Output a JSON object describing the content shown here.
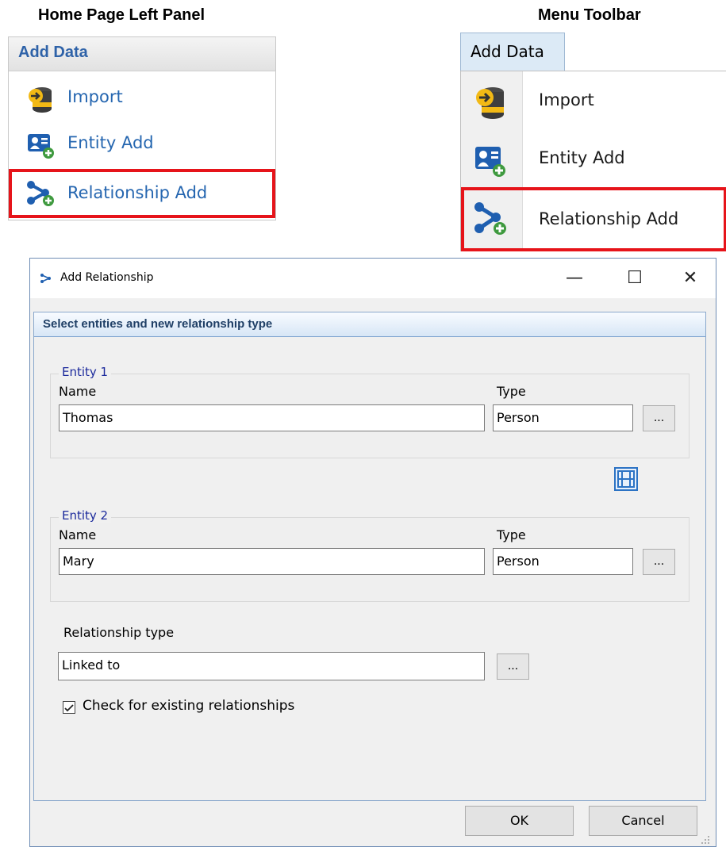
{
  "captions": {
    "left": "Home Page Left Panel",
    "right": "Menu Toolbar"
  },
  "left_panel": {
    "header": "Add Data",
    "items": [
      {
        "label": "Import",
        "icon": "import-database-icon"
      },
      {
        "label": "Entity Add",
        "icon": "entity-add-icon"
      },
      {
        "label": "Relationship Add",
        "icon": "relationship-add-icon",
        "highlighted": true
      }
    ]
  },
  "menu_toolbar": {
    "tab": "Add Data",
    "items": [
      {
        "label": "Import",
        "icon": "import-database-icon"
      },
      {
        "label": "Entity Add",
        "icon": "entity-add-icon"
      },
      {
        "label": "Relationship Add",
        "icon": "relationship-add-icon",
        "highlighted": true
      }
    ]
  },
  "dialog": {
    "title": "Add Relationship",
    "controls": {
      "minimize": "—",
      "maximize": "☐",
      "close": "✕"
    },
    "section_title": "Select entities and new relationship type",
    "entity1": {
      "legend": "Entity 1",
      "name_label": "Name",
      "type_label": "Type",
      "name": "Thomas",
      "type": "Person",
      "browse": "..."
    },
    "entity2": {
      "legend": "Entity 2",
      "name_label": "Name",
      "type_label": "Type",
      "name": "Mary",
      "type": "Person",
      "browse": "..."
    },
    "relationship_type_label": "Relationship type",
    "relationship_type": "Linked to",
    "relationship_browse": "...",
    "check_existing": {
      "label": "Check for existing relationships",
      "checked": true
    },
    "ok": "OK",
    "cancel": "Cancel"
  },
  "colors": {
    "highlight": "#e6141a",
    "accent_blue": "#2566b0",
    "legend_blue": "#1c2a9c"
  }
}
